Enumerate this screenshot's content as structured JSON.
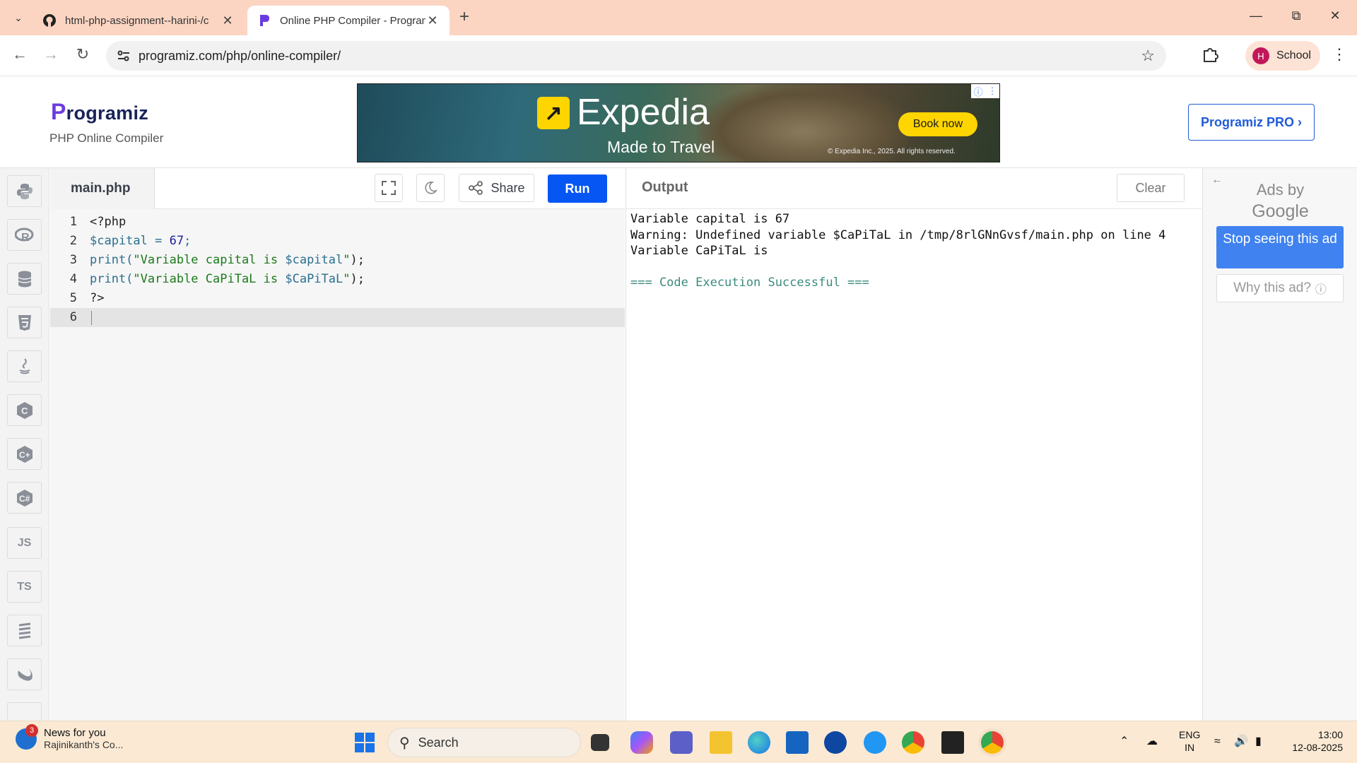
{
  "browser": {
    "tabs": [
      {
        "title": "html-php-assignment--harini-/c",
        "active": false
      },
      {
        "title": "Online PHP Compiler - Program",
        "active": true
      }
    ],
    "url": "programiz.com/php/online-compiler/",
    "profile_initial": "H",
    "profile_label": "School"
  },
  "site": {
    "logo_text": "rogramiz",
    "logo_letter": "P",
    "subtitle": "PHP Online Compiler",
    "pro_button": "Programiz PRO ›"
  },
  "banner_ad": {
    "brand": "Expedia",
    "tagline": "Made to Travel",
    "cta": "Book now",
    "copyright": "© Expedia Inc., 2025. All rights reserved."
  },
  "rail": {
    "items": [
      "python-icon",
      "r-icon",
      "sql-icon",
      "html5-icon",
      "java-icon",
      "c-icon",
      "cpp-icon",
      "csharp-icon",
      "JS",
      "TS",
      "go-icon",
      "swift-icon",
      "kotlin-icon"
    ]
  },
  "editor": {
    "filename": "main.php",
    "share_label": "Share",
    "run_label": "Run",
    "lines": [
      {
        "n": "1",
        "tokens": [
          {
            "t": "<?php",
            "c": ""
          }
        ]
      },
      {
        "n": "2",
        "tokens": [
          {
            "t": "$capital",
            "c": "t-var"
          },
          {
            "t": " = ",
            "c": "t-var"
          },
          {
            "t": "67",
            "c": "t-num"
          },
          {
            "t": ";",
            "c": "t-var"
          }
        ]
      },
      {
        "n": "3",
        "tokens": [
          {
            "t": "print(",
            "c": "t-var"
          },
          {
            "t": "\"Variable capital is ",
            "c": "t-str"
          },
          {
            "t": "$capital",
            "c": "t-strvar"
          },
          {
            "t": "\"",
            "c": "t-str"
          },
          {
            "t": ");",
            "c": ""
          }
        ]
      },
      {
        "n": "4",
        "tokens": [
          {
            "t": "print(",
            "c": "t-var"
          },
          {
            "t": "\"Variable CaPiTaL is ",
            "c": "t-str"
          },
          {
            "t": "$CaPiTaL",
            "c": "t-strvar"
          },
          {
            "t": "\"",
            "c": "t-str"
          },
          {
            "t": ");",
            "c": ""
          }
        ]
      },
      {
        "n": "5",
        "tokens": [
          {
            "t": "?>",
            "c": ""
          }
        ]
      },
      {
        "n": "6",
        "tokens": []
      }
    ],
    "current_line": 6
  },
  "output": {
    "title": "Output",
    "clear_label": "Clear",
    "lines": [
      {
        "text": "Variable capital is 67",
        "kind": "normal"
      },
      {
        "text": "Warning: Undefined variable $CaPiTaL in /tmp/8rlGNnGvsf/main.php on line 4",
        "kind": "normal"
      },
      {
        "text": "Variable CaPiTaL is",
        "kind": "normal"
      },
      {
        "text": "",
        "kind": "normal"
      },
      {
        "text": "=== Code Execution Successful ===",
        "kind": "ok"
      }
    ]
  },
  "side_ad": {
    "ads_by": "Ads by",
    "google": "Google",
    "stop": "Stop seeing this ad",
    "why": "Why this ad?"
  },
  "taskbar": {
    "news_badge": "3",
    "news_title": "News for you",
    "news_sub": "Rajinikanth's Co...",
    "search_placeholder": "Search",
    "lang_top": "ENG",
    "lang_bottom": "IN",
    "time": "13:00",
    "date": "12-08-2025"
  },
  "colors": {
    "run_button": "#0556f3",
    "tab_strip": "#fbd5c2",
    "success_text": "#3d8a7e"
  }
}
